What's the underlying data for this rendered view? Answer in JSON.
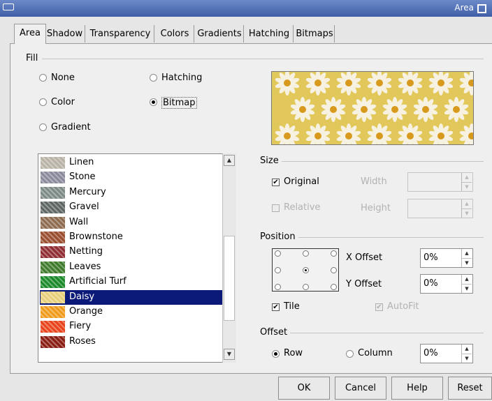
{
  "window": {
    "title": "Area"
  },
  "tabs": [
    "Area",
    "Shadow",
    "Transparency",
    "Colors",
    "Gradients",
    "Hatching",
    "Bitmaps"
  ],
  "active_tab": "Area",
  "fill": {
    "group_label": "Fill",
    "options": {
      "none": "None",
      "color": "Color",
      "gradient": "Gradient",
      "hatching": "Hatching",
      "bitmap": "Bitmap"
    },
    "selected": "Bitmap"
  },
  "bitmaps": {
    "items": [
      {
        "label": "Linen",
        "swatch": "#b9b2a6"
      },
      {
        "label": "Stone",
        "swatch": "#8a8a9c"
      },
      {
        "label": "Mercury",
        "swatch": "#7d8a86"
      },
      {
        "label": "Gravel",
        "swatch": "#5d6662"
      },
      {
        "label": "Wall",
        "swatch": "#8e6b4f"
      },
      {
        "label": "Brownstone",
        "swatch": "#9a4e2f"
      },
      {
        "label": "Netting",
        "swatch": "#8f2d32"
      },
      {
        "label": "Leaves",
        "swatch": "#3f7b2c"
      },
      {
        "label": "Artificial Turf",
        "swatch": "#1b8a2a"
      },
      {
        "label": "Daisy",
        "swatch": "#e8d07a"
      },
      {
        "label": "Orange",
        "swatch": "#f09a1a"
      },
      {
        "label": "Fiery",
        "swatch": "#e8431a"
      },
      {
        "label": "Roses",
        "swatch": "#8a1d12"
      }
    ],
    "selected": "Daisy"
  },
  "size": {
    "group_label": "Size",
    "original_label": "Original",
    "original_checked": true,
    "relative_label": "Relative",
    "relative_checked": false,
    "width_label": "Width",
    "height_label": "Height",
    "width_value": "",
    "height_value": ""
  },
  "position": {
    "group_label": "Position",
    "x_offset_label": "X Offset",
    "x_offset_value": "0%",
    "y_offset_label": "Y Offset",
    "y_offset_value": "0%",
    "tile_label": "Tile",
    "tile_checked": true,
    "autofit_label": "AutoFit",
    "autofit_checked": true,
    "selected_point": "center"
  },
  "offset": {
    "group_label": "Offset",
    "row_label": "Row",
    "column_label": "Column",
    "selected": "Row",
    "value": "0%"
  },
  "buttons": {
    "ok": "OK",
    "cancel": "Cancel",
    "help": "Help",
    "reset": "Reset"
  },
  "colors": {
    "title_bar": "#4a68b0",
    "selection": "#0b1a79",
    "preview_flower": "#f6f1e0",
    "preview_center": "#d89a1c"
  }
}
